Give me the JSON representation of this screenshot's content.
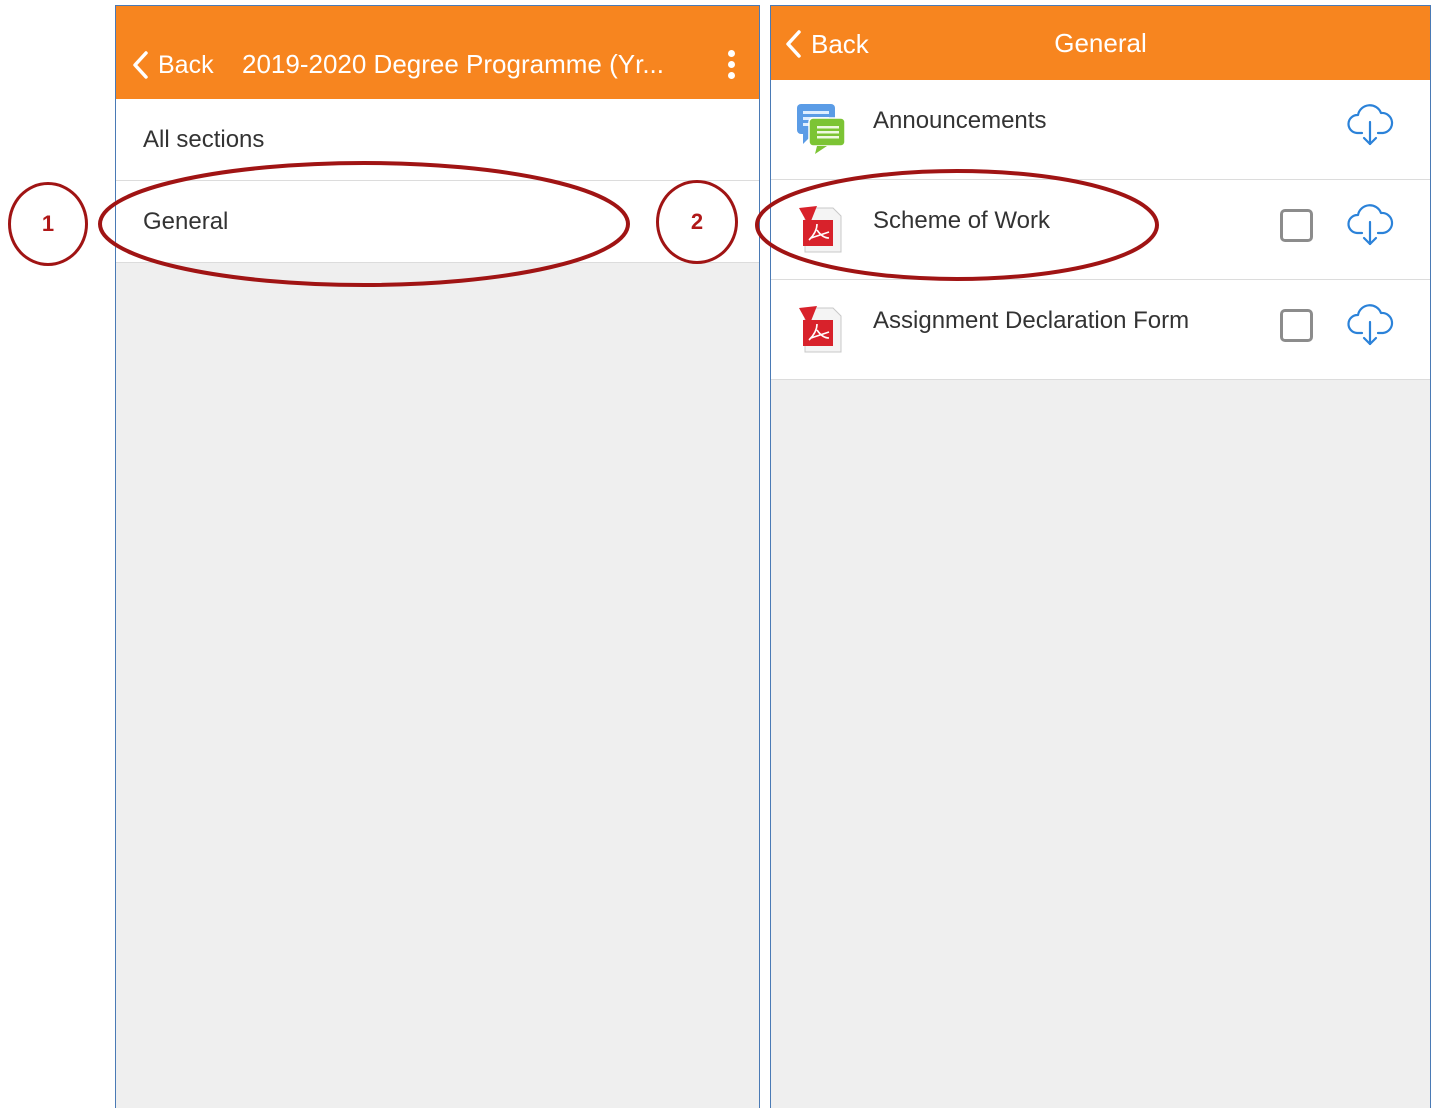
{
  "left_screen": {
    "back_label": "Back",
    "title": "2019-2020 Degree Programme (Yr...",
    "sections": [
      "All sections",
      "General"
    ]
  },
  "right_screen": {
    "back_label": "Back",
    "title": "General",
    "items": [
      {
        "label": "Announcements",
        "icon": "forum-icon"
      },
      {
        "label": "Scheme of Work",
        "icon": "pdf-file-icon"
      },
      {
        "label": "Assignment Declaration Form",
        "icon": "pdf-file-icon"
      }
    ]
  },
  "annotations": {
    "step_1": "1",
    "step_2": "2"
  },
  "colors": {
    "header_orange": "#f7851f",
    "annotation_red": "#a01414",
    "cloud_blue": "#2b82d9",
    "screen_border_blue": "#4a7ab5",
    "pdf_red": "#d8222b",
    "background_grey": "#efefef"
  }
}
